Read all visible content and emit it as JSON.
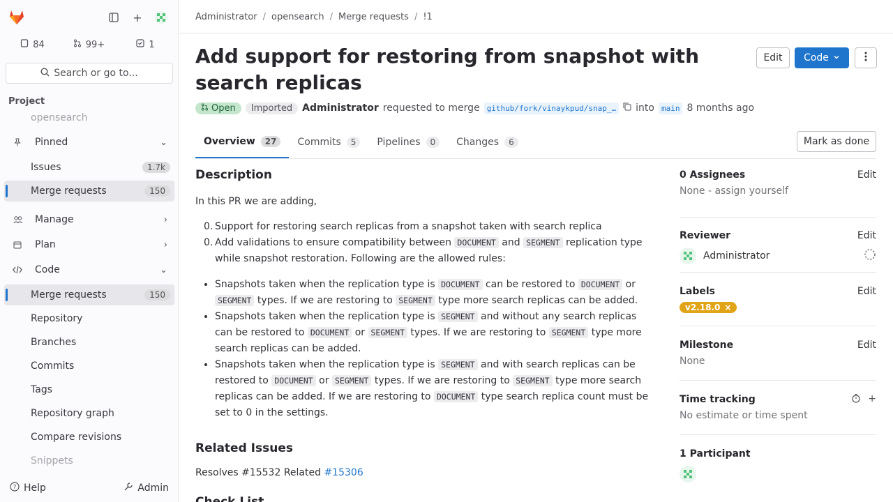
{
  "sidebar": {
    "counts": [
      {
        "icon": "issues-icon",
        "value": "84"
      },
      {
        "icon": "merge-request-icon",
        "value": "99+"
      },
      {
        "icon": "todo-icon",
        "value": "1"
      }
    ],
    "search_label": "Search or go to...",
    "project_label": "Project",
    "project_name": "opensearch",
    "items": [
      {
        "label": "Pinned",
        "icon": "pin-icon",
        "chevron": "⌄"
      },
      {
        "label": "Issues",
        "badge": "1.7k",
        "sub": true
      },
      {
        "label": "Merge requests",
        "badge": "150",
        "sub": true,
        "active": true
      },
      {
        "label": "Manage",
        "icon": "manage-icon",
        "chevron": "›"
      },
      {
        "label": "Plan",
        "icon": "plan-icon",
        "chevron": "›"
      },
      {
        "label": "Code",
        "icon": "code-icon",
        "chevron": "⌄"
      },
      {
        "label": "Merge requests",
        "badge": "150",
        "sub": true,
        "active": true
      },
      {
        "label": "Repository",
        "sub": true
      },
      {
        "label": "Branches",
        "sub": true
      },
      {
        "label": "Commits",
        "sub": true
      },
      {
        "label": "Tags",
        "sub": true
      },
      {
        "label": "Repository graph",
        "sub": true
      },
      {
        "label": "Compare revisions",
        "sub": true
      },
      {
        "label": "Snippets",
        "sub": true
      }
    ],
    "help_label": "Help",
    "admin_label": "Admin"
  },
  "breadcrumb": [
    "Administrator",
    "opensearch",
    "Merge requests",
    "!1"
  ],
  "mr": {
    "title": "Add support for restoring from snapshot with search replicas",
    "edit_label": "Edit",
    "code_label": "Code",
    "status": "Open",
    "imported": "Imported",
    "author": "Administrator",
    "requested_text": "requested to merge",
    "branch": "github/fork/vinaykpud/snap_…",
    "into_text": "into",
    "target": "main",
    "time": "8 months ago"
  },
  "tabs": [
    {
      "label": "Overview",
      "count": "27",
      "active": true
    },
    {
      "label": "Commits",
      "count": "5"
    },
    {
      "label": "Pipelines",
      "count": "0"
    },
    {
      "label": "Changes",
      "count": "6"
    }
  ],
  "mark_done_label": "Mark as done",
  "description": {
    "heading": "Description",
    "intro": "In this PR we are adding,",
    "related_heading": "Related Issues",
    "related_prefix": "Resolves #15532 Related",
    "related_link": "#15306",
    "checklist_heading": "Check List"
  },
  "right": {
    "assignees_title": "0 Assignees",
    "assignees_value": "None - assign yourself",
    "reviewer_title": "Reviewer",
    "reviewer_name": "Administrator",
    "labels_title": "Labels",
    "label_value": "v2.18.0",
    "milestone_title": "Milestone",
    "milestone_value": "None",
    "time_title": "Time tracking",
    "time_value": "No estimate or time spent",
    "participants_title": "1 Participant",
    "edit_label": "Edit"
  },
  "colors": {
    "accent": "#1f75cb",
    "open_bg": "#c3e6cd",
    "label_bg": "#e1a417"
  }
}
